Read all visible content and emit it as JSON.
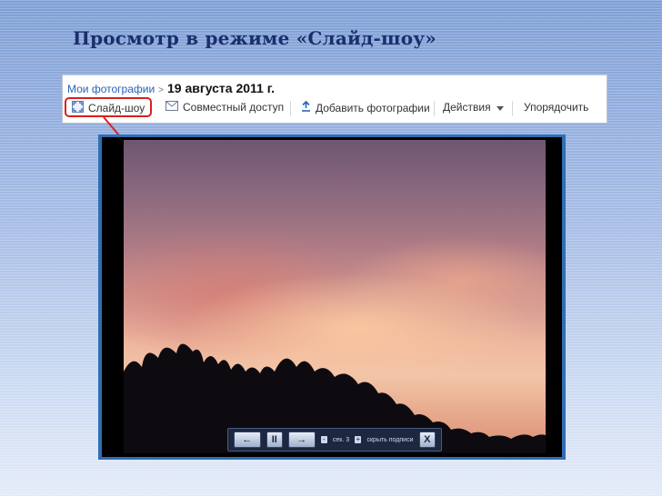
{
  "slide": {
    "title": "Просмотр в режиме «Слайд-шоу»"
  },
  "breadcrumb": {
    "root": "Мои фотографии",
    "separator": ">",
    "current": "19 августа 2011 г."
  },
  "toolbar": {
    "slideshow_label": "Слайд-шоу",
    "share_label": "Совместный доступ",
    "upload_label": "Добавить фотографии",
    "actions_label": "Действия",
    "sort_label": "Упорядочить"
  },
  "icons": {
    "slideshow": "fullscreen-icon",
    "share": "envelope-icon",
    "upload": "upload-arrow-icon",
    "actions": "chevron-down-icon"
  },
  "slideshow_controls": {
    "prev": "←",
    "pause": "II",
    "next": "→",
    "minus": "-",
    "seconds_label": "сек. 3",
    "plus": "+",
    "hide_captions": "скрыть подписи",
    "close": "X"
  },
  "colors": {
    "highlight": "#d92020",
    "frame": "#2f6fb2",
    "title": "#1b2e6b",
    "link": "#2a62b6"
  }
}
